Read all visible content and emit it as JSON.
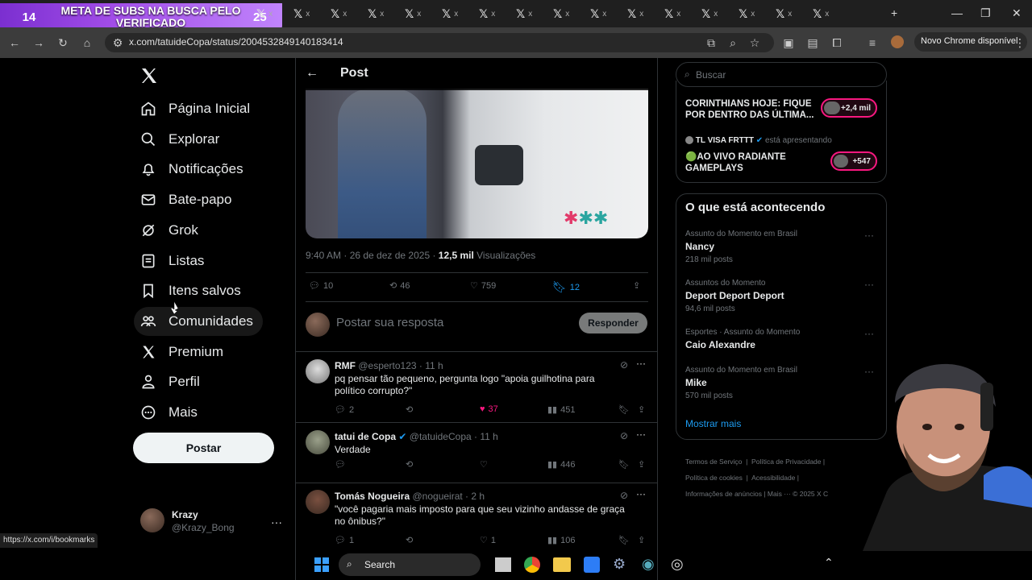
{
  "overlay": {
    "left_number": "14",
    "banner_text": "META DE SUBS NA BUSCA PELO VERIFICADO",
    "right_number": "25"
  },
  "browser": {
    "tab_count_x": 16,
    "url": "x.com/tatuideCopa/status/2004532849140183414",
    "new_chrome": "Novo Chrome disponível",
    "status_url": "https://x.com/i/bookmarks"
  },
  "nav": {
    "items": [
      {
        "label": "Página Inicial",
        "icon": "home-icon"
      },
      {
        "label": "Explorar",
        "icon": "search-icon"
      },
      {
        "label": "Notificações",
        "icon": "bell-icon"
      },
      {
        "label": "Bate-papo",
        "icon": "mail-icon"
      },
      {
        "label": "Grok",
        "icon": "grok-icon"
      },
      {
        "label": "Listas",
        "icon": "list-icon"
      },
      {
        "label": "Itens salvos",
        "icon": "bookmark-icon"
      },
      {
        "label": "Comunidades",
        "icon": "communities-icon"
      },
      {
        "label": "Premium",
        "icon": "x-premium-icon"
      },
      {
        "label": "Perfil",
        "icon": "person-icon"
      },
      {
        "label": "Mais",
        "icon": "more-circle-icon"
      }
    ],
    "post_button": "Postar",
    "account": {
      "name": "Krazy",
      "handle": "@Krazy_Bong"
    }
  },
  "post": {
    "header": "Post",
    "time": "9:40 AM · 26 de dez de 2025 · ",
    "views_count": "12,5 mil",
    "views_label": " Visualizações",
    "replies": "10",
    "reposts": "46",
    "likes": "759",
    "bookmarks": "12",
    "reply_placeholder": "Postar sua resposta",
    "reply_button": "Responder"
  },
  "replies": [
    {
      "name": "RMF",
      "handle": "@esperto123 · 11 h",
      "text": "pq pensar tão pequeno, pergunta logo \"apoia guilhotina para político corrupto?\"",
      "replies": "2",
      "reposts": "",
      "likes": "37",
      "views": "451",
      "liked": true
    },
    {
      "name": "tatui de Copa",
      "handle": "@tatuideCopa · 11 h",
      "text": "Verdade",
      "replies": "",
      "reposts": "",
      "likes": "",
      "views": "446",
      "verified": true
    },
    {
      "name": "Tomás Nogueira",
      "handle": "@nogueirat · 2 h",
      "text": "\"você pagaria mais imposto para que seu vizinho andasse de graça no ônibus?\"",
      "replies": "1",
      "reposts": "",
      "likes": "1",
      "views": "106"
    }
  ],
  "right": {
    "search_placeholder": "Buscar",
    "live": [
      {
        "title": "CORINTHIANS HOJE: FIQUE POR DENTRO DAS ÚLTIMA...",
        "count": "+2,4 mil"
      },
      {
        "host": "TL VISA FRTTT",
        "host_suffix": " está apresentando",
        "title": "🟢AO VIVO RADIANTE GAMEPLAYS",
        "count": "+547"
      }
    ],
    "trends_title": "O que está acontecendo",
    "trends": [
      {
        "category": "Assunto do Momento em Brasil",
        "title": "Nancy",
        "posts": "218 mil posts"
      },
      {
        "category": "Assuntos do Momento",
        "title": "Deport Deport Deport",
        "posts": "94,6 mil posts"
      },
      {
        "category": "Esportes · Assunto do Momento",
        "title": "Caio Alexandre",
        "posts": ""
      },
      {
        "category": "Assunto do Momento em Brasil",
        "title": "Mike",
        "posts": "570 mil posts"
      }
    ],
    "show_more": "Mostrar mais",
    "footer": [
      "Termos de Serviço",
      "Política de Privacidade",
      "Política de cookies",
      "Acessibilidade",
      "Informações de anúncios",
      "Mais ···",
      "© 2025 X C"
    ]
  },
  "taskbar": {
    "search": "Search"
  },
  "colors": {
    "accent": "#1d9bf0",
    "like": "#f91880",
    "banner": "#a24de8"
  }
}
